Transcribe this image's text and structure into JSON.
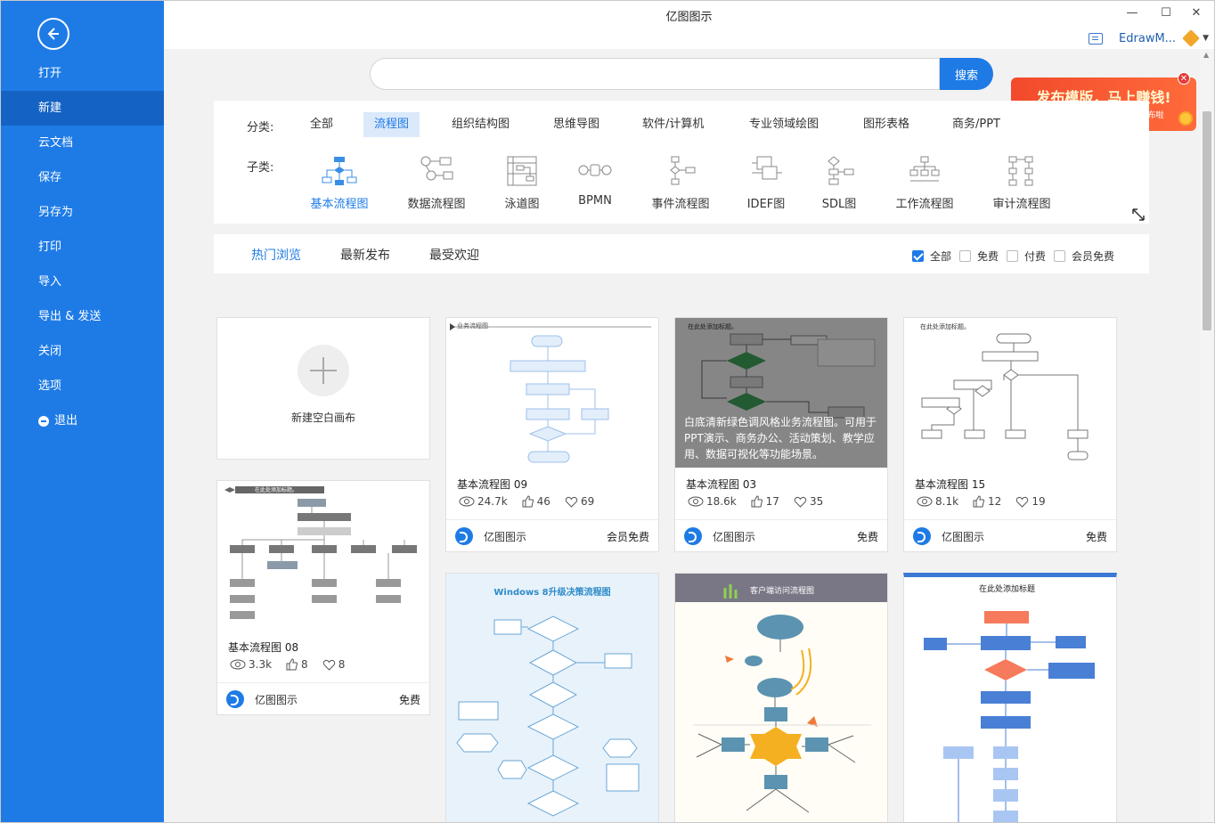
{
  "app": {
    "title": "亿图图示",
    "user": "EdrawM..."
  },
  "window": {
    "minimize": "—",
    "maximize": "☐",
    "close": "✕"
  },
  "sidebar": {
    "items": [
      {
        "label": "打开"
      },
      {
        "label": "新建",
        "active": true
      },
      {
        "label": "云文档"
      },
      {
        "label": "保存"
      },
      {
        "label": "另存为"
      },
      {
        "label": "打印"
      },
      {
        "label": "导入"
      },
      {
        "label": "导出 & 发送"
      },
      {
        "label": "关闭"
      },
      {
        "label": "选项"
      },
      {
        "label": "退出"
      }
    ]
  },
  "search": {
    "value": "",
    "placeholder": "",
    "button": "搜索"
  },
  "promo": {
    "title": "发布模版，马上赚钱!",
    "subtitle": "编辑页右上角点击 “ ” 就可发布啦"
  },
  "filters": {
    "category_label": "分类:",
    "sub_label": "子类:",
    "categories": [
      "全部",
      "流程图",
      "组织结构图",
      "思维导图",
      "软件/计算机",
      "专业领域绘图",
      "图形表格",
      "商务/PPT"
    ],
    "subcategories": [
      "基本流程图",
      "数据流程图",
      "泳道图",
      "BPMN",
      "事件流程图",
      "IDEF图",
      "SDL图",
      "工作流程图",
      "审计流程图"
    ]
  },
  "tabs": [
    "热门浏览",
    "最新发布",
    "最受欢迎"
  ],
  "checks": [
    {
      "label": "全部",
      "checked": true
    },
    {
      "label": "免费",
      "checked": false
    },
    {
      "label": "付费",
      "checked": false
    },
    {
      "label": "会员免费",
      "checked": false
    }
  ],
  "new_blank": "新建空白画布",
  "cards": [
    {
      "title": "基本流程图 09",
      "views": "24.7k",
      "likes": "46",
      "favs": "69",
      "author": "亿图图示",
      "price": "会员免费",
      "thumb_title": "业务流程图"
    },
    {
      "title": "基本流程图 03",
      "views": "18.6k",
      "likes": "17",
      "favs": "35",
      "author": "亿图图示",
      "price": "免费",
      "thumb_title": "在此处添加标题。",
      "overlay": "白底清新绿色调风格业务流程图。可用于PPT演示、商务办公、活动策划、教学应用、数据可视化等功能场景。"
    },
    {
      "title": "基本流程图 15",
      "views": "8.1k",
      "likes": "12",
      "favs": "19",
      "author": "亿图图示",
      "price": "免费",
      "thumb_title": "在此处添加标题。"
    },
    {
      "title": "基本流程图 08",
      "views": "3.3k",
      "likes": "8",
      "favs": "8",
      "author": "亿图图示",
      "price": "免费",
      "thumb_title": "在此处添加标题。"
    }
  ],
  "lower_cards": [
    {
      "thumb_title": "Windows 8升级决策流程图"
    },
    {
      "thumb_title": "客户端访问流程图"
    },
    {
      "thumb_title": "在此处添加标题"
    }
  ]
}
